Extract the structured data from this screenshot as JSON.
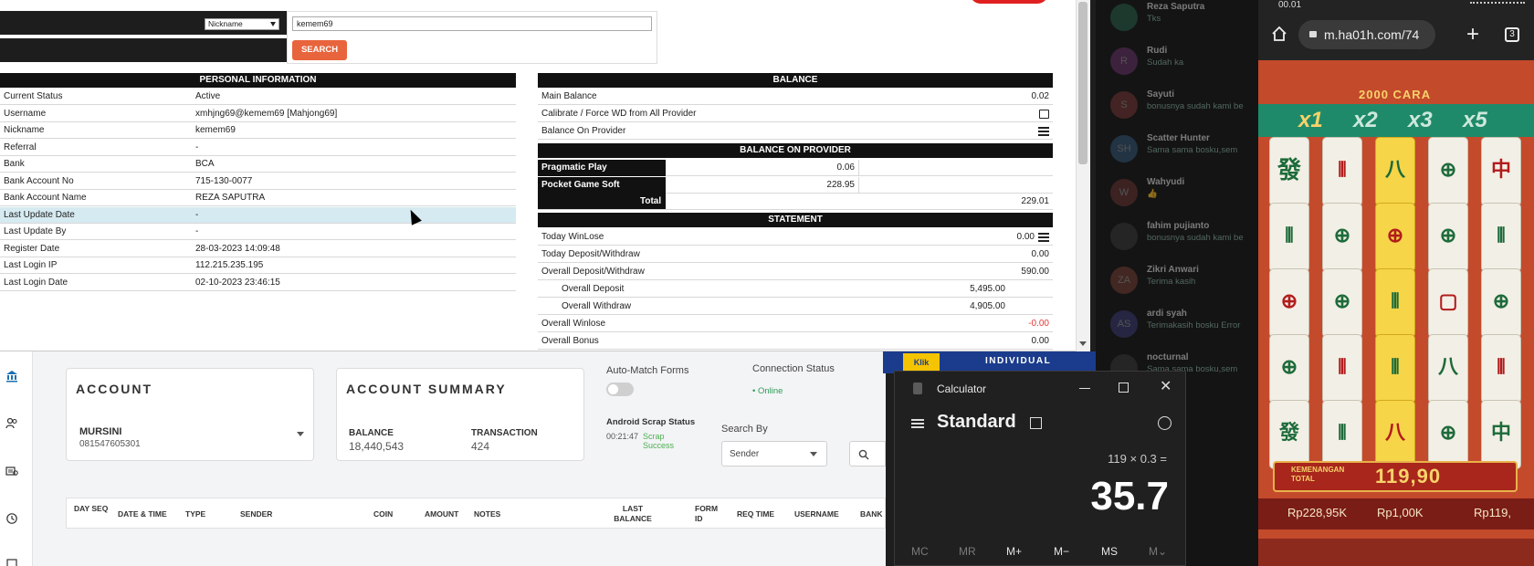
{
  "admin": {
    "search": {
      "select_value": "Nickname",
      "input_value": "kemem69",
      "button_label": "SEARCH"
    },
    "personal": {
      "title": "PERSONAL INFORMATION",
      "rows": [
        {
          "label": "Current Status",
          "value": "Active"
        },
        {
          "label": "Username",
          "value": "xmhjng69@kemem69  [Mahjong69]"
        },
        {
          "label": "Nickname",
          "value": "kemem69"
        },
        {
          "label": "Referral",
          "value": "-"
        },
        {
          "label": "Bank",
          "value": "BCA"
        },
        {
          "label": "Bank Account No",
          "value": "715-130-0077"
        },
        {
          "label": "Bank Account Name",
          "value": "REZA SAPUTRA"
        },
        {
          "label": "Last Update Date",
          "value": "-"
        },
        {
          "label": "Last Update By",
          "value": "-"
        },
        {
          "label": "Register Date",
          "value": "28-03-2023 14:09:48"
        },
        {
          "label": "Last Login IP",
          "value": "112.215.235.195"
        },
        {
          "label": "Last Login Date",
          "value": "02-10-2023 23:46:15"
        }
      ]
    },
    "balance": {
      "title": "BALANCE",
      "main_label": "Main Balance",
      "main_value": "0.02",
      "calibrate_label": "Calibrate / Force WD from All Provider",
      "on_provider_label": "Balance On Provider"
    },
    "provider": {
      "title": "BALANCE ON PROVIDER",
      "rows": [
        {
          "name": "Pragmatic Play",
          "value": "0.06"
        },
        {
          "name": "Pocket Game Soft",
          "value": "228.95"
        }
      ],
      "total_label": "Total",
      "total_value": "229.01"
    },
    "statement": {
      "title": "STATEMENT",
      "today_winlose_label": "Today WinLose",
      "today_winlose_value": "0.00",
      "today_dw_label": "Today Deposit/Withdraw",
      "today_dw_value": "0.00",
      "overall_dw_label": "Overall Deposit/Withdraw",
      "overall_dw_value": "590.00",
      "overall_deposit_label": "Overall Deposit",
      "overall_deposit_value": "5,495.00",
      "overall_withdraw_label": "Overall Withdraw",
      "overall_withdraw_value": "4,905.00",
      "overall_winlose_label": "Overall Winlose",
      "overall_winlose_value": "-0.00",
      "overall_bonus_label": "Overall Bonus",
      "overall_bonus_value": "0.00"
    }
  },
  "dashboard": {
    "account": {
      "title": "ACCOUNT",
      "name": "MURSINI",
      "number": "081547605301"
    },
    "summary": {
      "title": "ACCOUNT SUMMARY",
      "balance_label": "BALANCE",
      "balance_value": "18,440,543",
      "transaction_label": "TRANSACTION",
      "transaction_value": "424"
    },
    "auto_match_label": "Auto-Match Forms",
    "connection_label": "Connection Status",
    "connection_value": "• Online",
    "android_label": "Android Scrap Status",
    "android_time": "00:21:47",
    "android_status": "Scrap Success",
    "search_by_label": "Search By",
    "search_by_value": "Sender",
    "table_headers": [
      "DAY SEQ",
      "DATE & TIME",
      "TYPE",
      "SENDER",
      "COIN",
      "AMOUNT",
      "NOTES",
      "LAST BALANCE",
      "FORM ID",
      "REQ TIME",
      "USERNAME",
      "BANK"
    ]
  },
  "ad": {
    "top": "Klik",
    "label": "INDIVIDUAL"
  },
  "calculator": {
    "title": "Calculator",
    "mode": "Standard",
    "expression": "119 × 0.3 =",
    "result": "35.7",
    "memory_buttons": [
      "MC",
      "MR",
      "M+",
      "M−",
      "MS",
      "M⌄"
    ]
  },
  "chat": {
    "items": [
      {
        "name": "Reza Saputra",
        "msg": "Tks",
        "initials": ""
      },
      {
        "name": "Rudi",
        "msg": "Sudah ka",
        "initials": "R"
      },
      {
        "name": "Sayuti",
        "msg": "bonusnya sudah kami be",
        "initials": "S"
      },
      {
        "name": "Scatter Hunter",
        "msg": "Sama sama bosku,sem",
        "initials": "SH"
      },
      {
        "name": "Wahyudi",
        "msg": "👍",
        "initials": "W"
      },
      {
        "name": "fahim pujianto",
        "msg": "bonusnya sudah kami be",
        "initials": ""
      },
      {
        "name": "Zikri Anwari",
        "msg": "Terima kasih",
        "initials": "ZA"
      },
      {
        "name": "ardi syah",
        "msg": "Terimakasih bosku Error",
        "initials": "AS"
      },
      {
        "name": "nocturnal",
        "msg": "Sama sama bosku,sem",
        "initials": ""
      }
    ]
  },
  "phone": {
    "status_time": "00.01",
    "url": "m.ha01h.com/74",
    "tab_count": "3",
    "banner": "2000 CARA",
    "multipliers": [
      "x1",
      "x2",
      "x3",
      "x5"
    ],
    "win_label": "KEMENANGAN TOTAL",
    "win_value": "119,90",
    "balance_1": "Rp228,95K",
    "balance_2": "Rp1,00K",
    "balance_3": "Rp119,"
  },
  "colors": {
    "search_button": "#e8643c",
    "header_black": "#111111",
    "highlight_row": "#d6eaf1",
    "negative": "#e53935",
    "online": "#2e9b57",
    "game_red": "#c44a2c"
  }
}
